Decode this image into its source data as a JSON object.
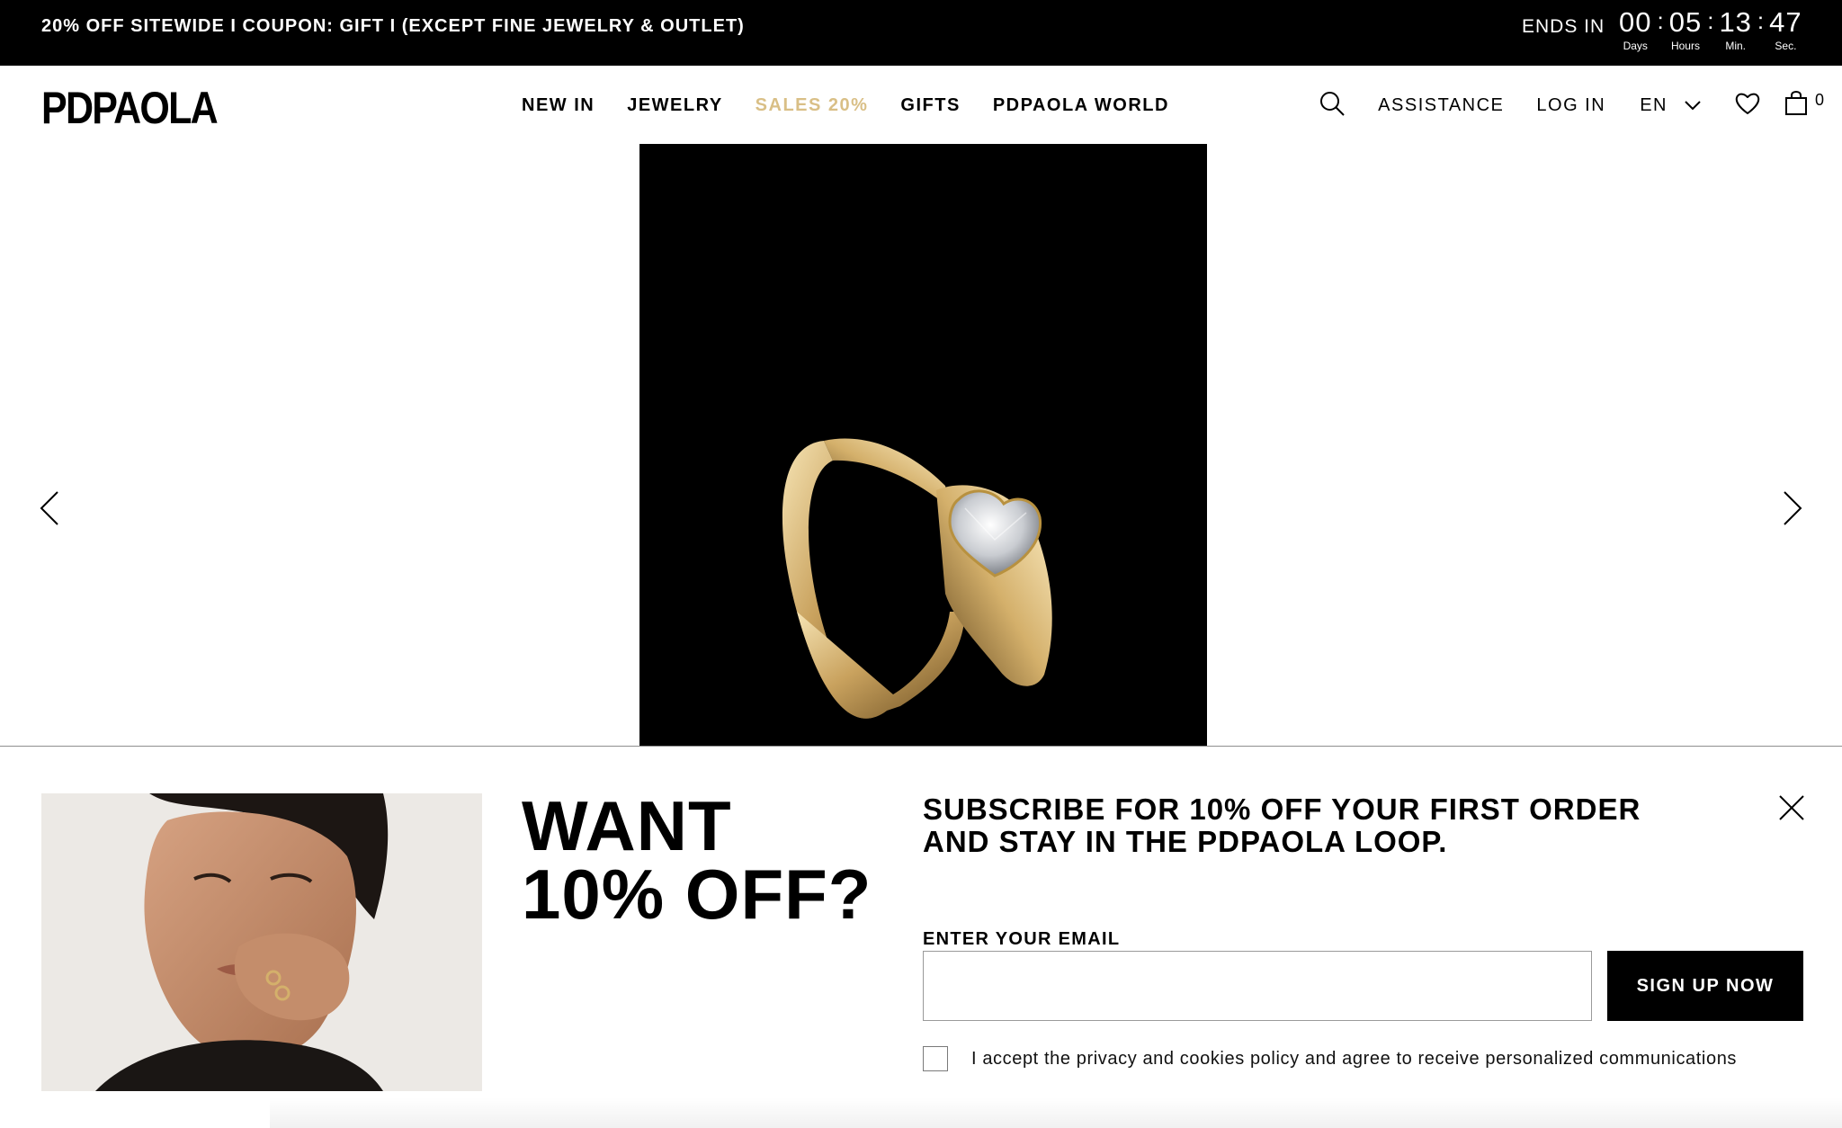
{
  "promo_bar": {
    "text": "20% OFF SITEWIDE I COUPON: GIFT I  (EXCEPT FINE JEWELRY & OUTLET)",
    "ends_in_label": "ENDS IN",
    "countdown": [
      {
        "value": "00",
        "label": "Days"
      },
      {
        "value": "05",
        "label": "Hours"
      },
      {
        "value": "13",
        "label": "Min."
      },
      {
        "value": "47",
        "label": "Sec."
      }
    ],
    "separator": ":"
  },
  "header": {
    "logo": "PDPAOLA",
    "nav": [
      {
        "label": "NEW IN"
      },
      {
        "label": "JEWELRY"
      },
      {
        "label": "SALES 20%"
      },
      {
        "label": "GIFTS"
      },
      {
        "label": "PDPAOLA WORLD"
      }
    ],
    "assistance": "ASSISTANCE",
    "login": "LOG IN",
    "language": "EN",
    "cart_count": "0",
    "icons": [
      "search-icon",
      "chevron-down-icon",
      "heart-icon",
      "shopping-bag-icon"
    ],
    "sale_color": "#d9bf86"
  },
  "hero": {
    "image": "gold ring with heart-shaped stone on black background",
    "prev_icon": "chevron-left-icon",
    "next_icon": "chevron-right-icon"
  },
  "newsletter": {
    "headline_line1": "WANT",
    "headline_line2": "10% OFF?",
    "subheadline_line1": "SUBSCRIBE FOR 10% OFF YOUR FIRST ORDER",
    "subheadline_line2": "AND STAY IN THE PDPAOLA LOOP.",
    "email_label": "ENTER YOUR EMAIL",
    "email_value": "",
    "signup_label": "SIGN UP NOW",
    "consent_text": "I accept the privacy and cookies policy and agree to receive personalized communications",
    "close_icon": "close-icon",
    "photo": "woman with gold rings touching her face"
  }
}
